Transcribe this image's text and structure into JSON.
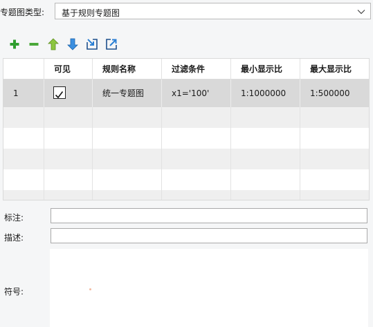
{
  "thematic_type": {
    "label": "专题图类型:",
    "value": "基于规则专题图"
  },
  "toolbar": {
    "icons": [
      "add-icon",
      "remove-icon",
      "move-up-icon",
      "move-down-icon",
      "import-icon",
      "export-icon"
    ]
  },
  "table": {
    "columns": [
      "",
      "可见",
      "规则名称",
      "过滤条件",
      "最小显示比",
      "最大显示比"
    ],
    "rows": [
      {
        "index": "1",
        "visible": true,
        "rule_name": "统一专题图",
        "filter": "x1='100'",
        "min_scale": "1:1000000",
        "max_scale": "1:500000"
      }
    ]
  },
  "fields": {
    "annotation_label": "标注:",
    "annotation_value": "",
    "description_label": "描述:",
    "description_value": "",
    "symbol_label": "符号:"
  },
  "colors": {
    "add": "#2f9e2f",
    "up": "#7ab32e",
    "down": "#2a7fd4",
    "selected_row": "#d9d9d9"
  }
}
